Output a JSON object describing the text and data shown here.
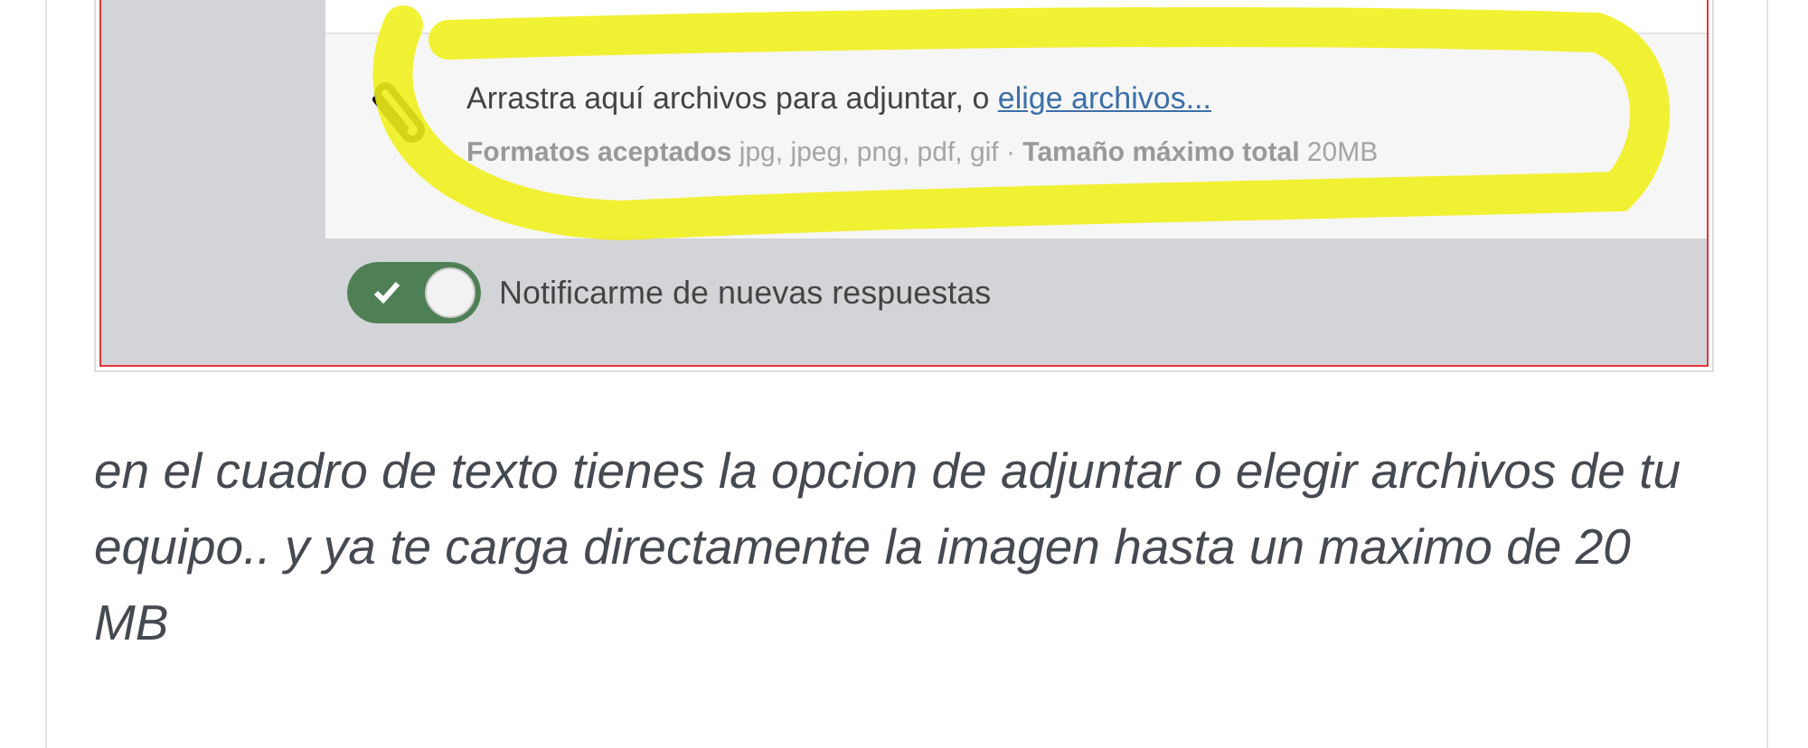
{
  "screenshot": {
    "attach_hint": "Arrastra aquí archivos para adjuntar, o ",
    "attach_link": "elige archivos...",
    "formats": "**Formatos aceptados** jpg, jpeg, png, pdf, gif · **Tamaño máximo total** 20MB",
    "notify_toggle": {
      "label": "Notificarme de nuevas respuestas",
      "on": true
    }
  },
  "post_text": "en el cuadro de texto tienes la opcion de adjuntar o elegir archivos de tu equipo.. y ya te carga directamente la imagen hasta un maximo de 20 MB"
}
